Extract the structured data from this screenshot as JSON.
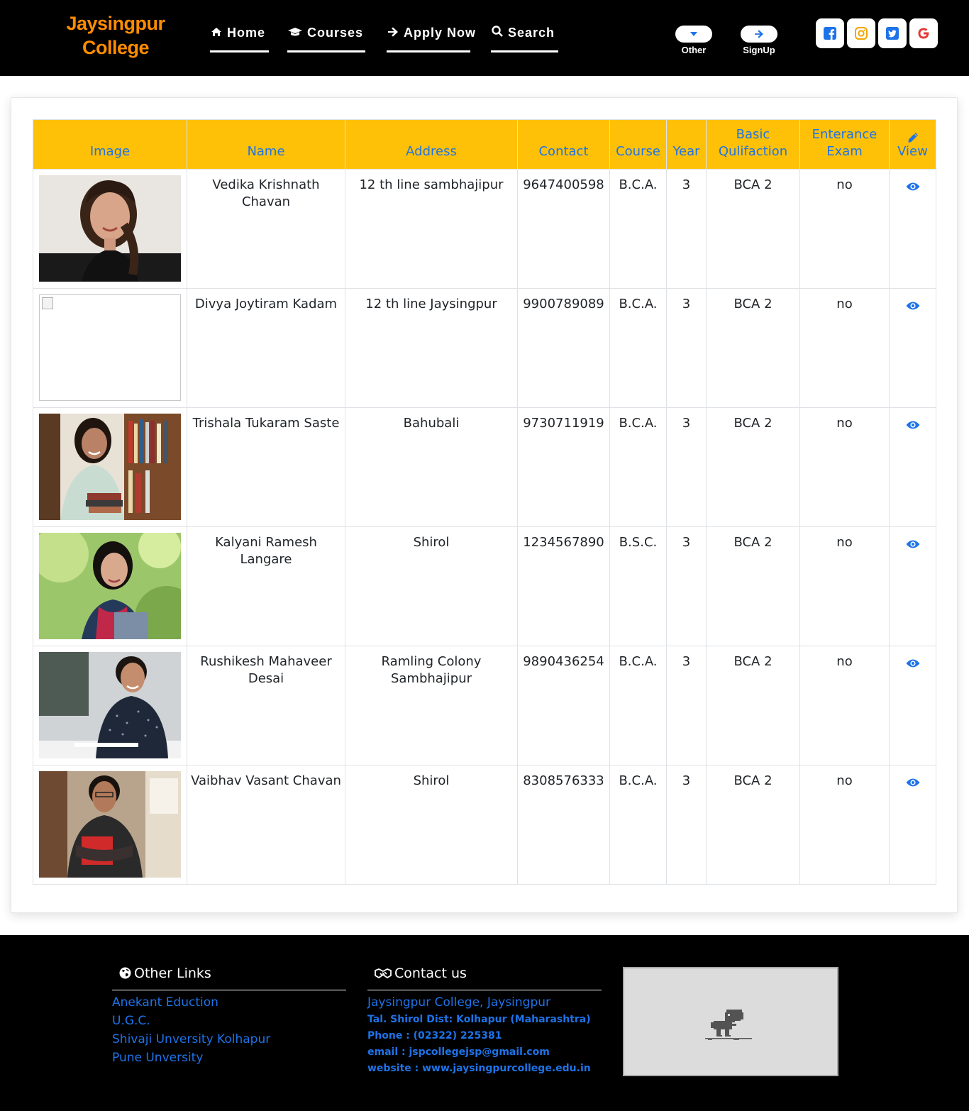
{
  "header": {
    "brand_line1": "Jaysingpur",
    "brand_line2": "College",
    "nav": [
      {
        "label": "Home",
        "icon": "home-icon"
      },
      {
        "label": "Courses",
        "icon": "graduation-cap-icon"
      },
      {
        "label": "Apply Now",
        "icon": "arrow-right-icon"
      },
      {
        "label": "Search",
        "icon": "search-icon"
      }
    ],
    "other_label": "Other",
    "signup_label": "SignUp",
    "social": [
      "facebook-icon",
      "instagram-icon",
      "twitter-icon",
      "google-icon"
    ],
    "colors": {
      "brand": "#ff8c00",
      "bar": "#000000"
    }
  },
  "table": {
    "columns": [
      "Image",
      "Name",
      "Address",
      "Contact",
      "Course",
      "Year",
      "Basic Qulifaction",
      "Enterance Exam",
      "View"
    ],
    "header_color": "#ffc107",
    "header_text_color": "#1e73e8",
    "rows": [
      {
        "image": "woman-portrait-braid",
        "name": "Vedika Krishnath Chavan",
        "address": "12 th line sambhajipur",
        "contact": "9647400598",
        "course": "B.C.A.",
        "year": "3",
        "qualification": "BCA 2",
        "exam": "no"
      },
      {
        "image": "broken-image",
        "name": "Divya Joytiram Kadam",
        "address": "12 th line Jaysingpur",
        "contact": "9900789089",
        "course": "B.C.A.",
        "year": "3",
        "qualification": "BCA 2",
        "exam": "no"
      },
      {
        "image": "student-with-books-library",
        "name": "Trishala Tukaram Saste",
        "address": "Bahubali",
        "contact": "9730711919",
        "course": "B.C.A.",
        "year": "3",
        "qualification": "BCA 2",
        "exam": "no"
      },
      {
        "image": "student-outdoors-backpack",
        "name": "Kalyani Ramesh Langare",
        "address": "Shirol",
        "contact": "1234567890",
        "course": "B.S.C.",
        "year": "3",
        "qualification": "BCA 2",
        "exam": "no"
      },
      {
        "image": "student-writing-classroom",
        "name": "Rushikesh Mahaveer Desai",
        "address": "Ramling Colony Sambhajipur",
        "contact": "9890436254",
        "course": "B.C.A.",
        "year": "3",
        "qualification": "BCA 2",
        "exam": "no"
      },
      {
        "image": "student-holding-folder",
        "name": "Vaibhav Vasant Chavan",
        "address": "Shirol",
        "contact": "8308576333",
        "course": "B.C.A.",
        "year": "3",
        "qualification": "BCA 2",
        "exam": "no"
      }
    ]
  },
  "footer": {
    "links_heading": "Other Links",
    "links": [
      "Anekant Eduction",
      "U.G.C.",
      "Shivaji Unversity Kolhapur",
      "Pune Unversity"
    ],
    "contact_heading": "Contact us",
    "contact_title": "Jaysingpur College, Jaysingpur",
    "contact_lines": [
      "Tal. Shirol Dist: Kolhapur (Maharashtra)",
      "Phone : (02322) 225381",
      "email : jspcollegejsp@gmail.com",
      "website : www.jaysingpurcollege.edu.in"
    ],
    "link_color": "#1e73e8"
  }
}
